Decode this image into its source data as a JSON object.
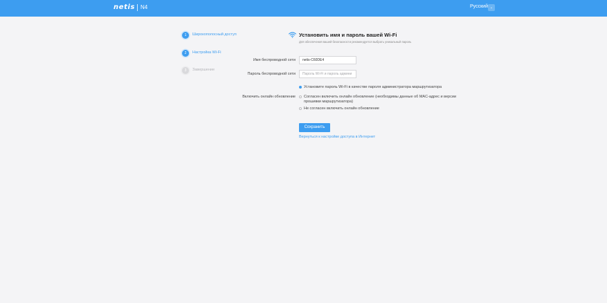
{
  "header": {
    "logo_text": "netis",
    "model": "N4",
    "language": "Русский",
    "language_dropdown_glyph": "⌄",
    "background_color": "#3d9df0"
  },
  "steps": [
    {
      "number": "1",
      "label": "Широкополосный доступ",
      "state": "active"
    },
    {
      "number": "2",
      "label": "Настройка Wi-Fi",
      "state": "active"
    },
    {
      "number": "3",
      "label": "Завершение",
      "state": "inactive"
    }
  ],
  "main": {
    "icon": "wifi-icon",
    "title": "Установить имя и пароль вашей Wi-Fi",
    "subtitle": "Для обеспечения вашей безопасности рекомендуется выбрать уникальный пароль",
    "ssid_label": "Имя беспроводной сети",
    "ssid_value": "netis-C60DE4",
    "password_label": "Пароль беспроводной сети",
    "password_placeholder": "Пароль Wi-Fi и пароль админи",
    "admin_option": "Установите пароль Wi-Fi в качестве пароля администратора маршрутизатора",
    "online_update_label": "Включить онлайн обновление",
    "online_update_options": [
      {
        "label": "Согласен включить онлайн обновление (необходимы данные об MAC-адрес и версии прошивки маршрутизатора)",
        "checked": false
      },
      {
        "label": "Не согласен включить онлайн обновление",
        "checked": false
      }
    ],
    "save_button": "Сохранить",
    "back_link": "Вернуться к настройке доступа в Интернет"
  },
  "colors": {
    "accent": "#3d9df0",
    "background": "#f4f4f6"
  }
}
